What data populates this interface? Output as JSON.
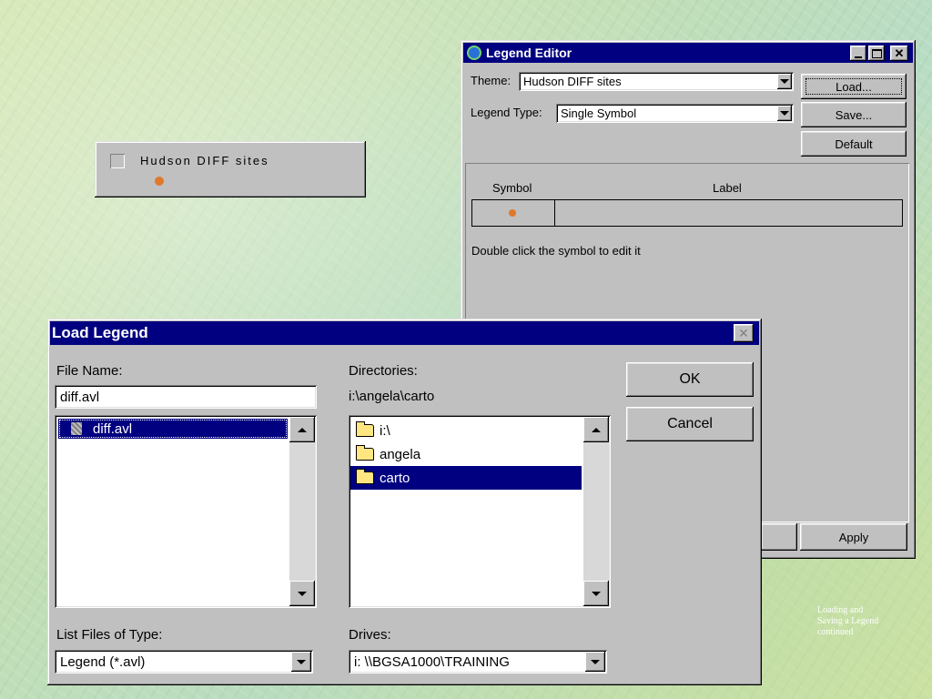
{
  "legend_box": {
    "label": "Hudson DIFF sites",
    "dot_color": "#e0782a"
  },
  "legend_editor": {
    "title": "Legend Editor",
    "theme_label": "Theme:",
    "theme_value": "Hudson DIFF sites",
    "legend_type_label": "Legend Type:",
    "legend_type_value": "Single Symbol",
    "load_label": "Load...",
    "save_label": "Save...",
    "default_label": "Default",
    "symbol_header": "Symbol",
    "label_header": "Label",
    "hint": "Double click the symbol to edit it",
    "apply_label": "Apply",
    "symbol_color": "#e0782a"
  },
  "load_legend": {
    "title": "Load Legend",
    "file_name_label": "File Name:",
    "file_name_value": "diff.avl",
    "files": [
      "diff.avl"
    ],
    "directories_label": "Directories:",
    "current_dir": "i:\\angela\\carto",
    "dirs": [
      "i:\\",
      "angela",
      "carto"
    ],
    "ok_label": "OK",
    "cancel_label": "Cancel",
    "list_type_label": "List Files of Type:",
    "list_type_value": "Legend (*.avl)",
    "drives_label": "Drives:",
    "drives_value": "i: \\\\BGSA1000\\TRAINING"
  },
  "caption": {
    "line1": "Loading and",
    "line2": "Saving a Legend",
    "line3": "continued"
  },
  "colors": {
    "title_bar": "#000080",
    "selection": "#000080",
    "dialog_face": "#c0c0c0"
  }
}
